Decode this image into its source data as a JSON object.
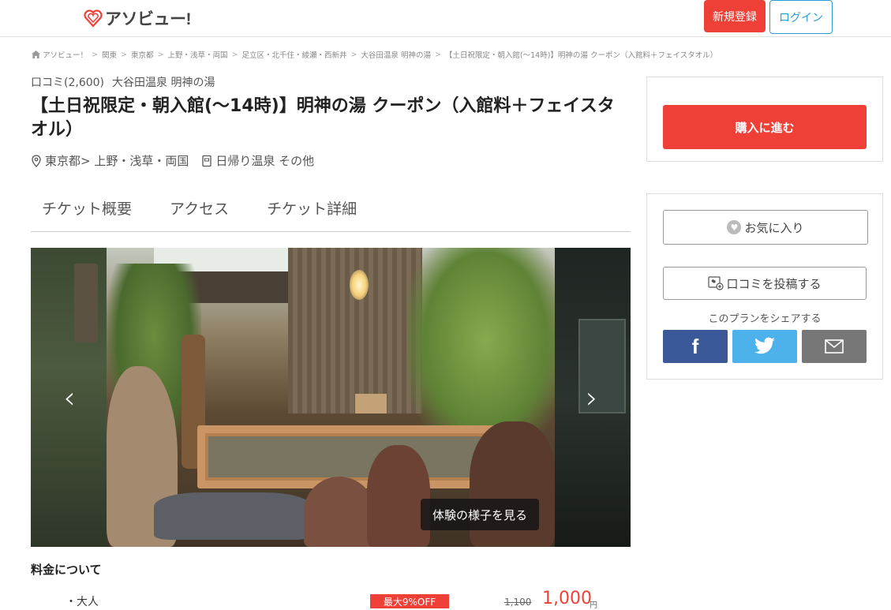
{
  "header": {
    "logo_text": "アソビュー!",
    "register_label": "新規登録",
    "login_label": "ログイン"
  },
  "breadcrumb": [
    "アソビュー！",
    "関東",
    "東京都",
    "上野・浅草・両国",
    "足立区・北千住・綾瀬・西新井",
    "大谷田温泉 明神の湯",
    "【土日祝限定・朝入館(〜14時)】明神の湯 クーポン（入館料＋フェイスタオル）"
  ],
  "review": {
    "count_label": "口コミ(2,600)",
    "place": "大谷田温泉 明神の湯"
  },
  "title": "【土日祝限定・朝入館(〜14時)】明神の湯 クーポン（入館料＋フェイスタオル）",
  "meta": {
    "location": "東京都> 上野・浅草・両国",
    "category": "日帰り温泉 その他"
  },
  "tabs": [
    {
      "label": "チケット概要"
    },
    {
      "label": "アクセス"
    },
    {
      "label": "チケット詳細"
    }
  ],
  "gallery": {
    "prev_arrow": "‹",
    "next_arrow": "›",
    "experience_label": "体験の様子を見る"
  },
  "price": {
    "section_title": "料金について",
    "rows": [
      {
        "label": "・大人",
        "badge": "最大9%OFF",
        "original": "1,100",
        "current": "1,000",
        "unit": "円"
      }
    ]
  },
  "sidebar": {
    "buy_label": "購入に進む",
    "favorite_label": "お気に入り",
    "review_post_label": "口コミを投稿する",
    "share_label": "このプランをシェアする",
    "facebook_glyph": "f"
  },
  "colors": {
    "accent": "#ef4038",
    "login_blue": "#2b9bd3",
    "facebook": "#3b5998",
    "twitter": "#4db2ec",
    "mail": "#777777"
  }
}
